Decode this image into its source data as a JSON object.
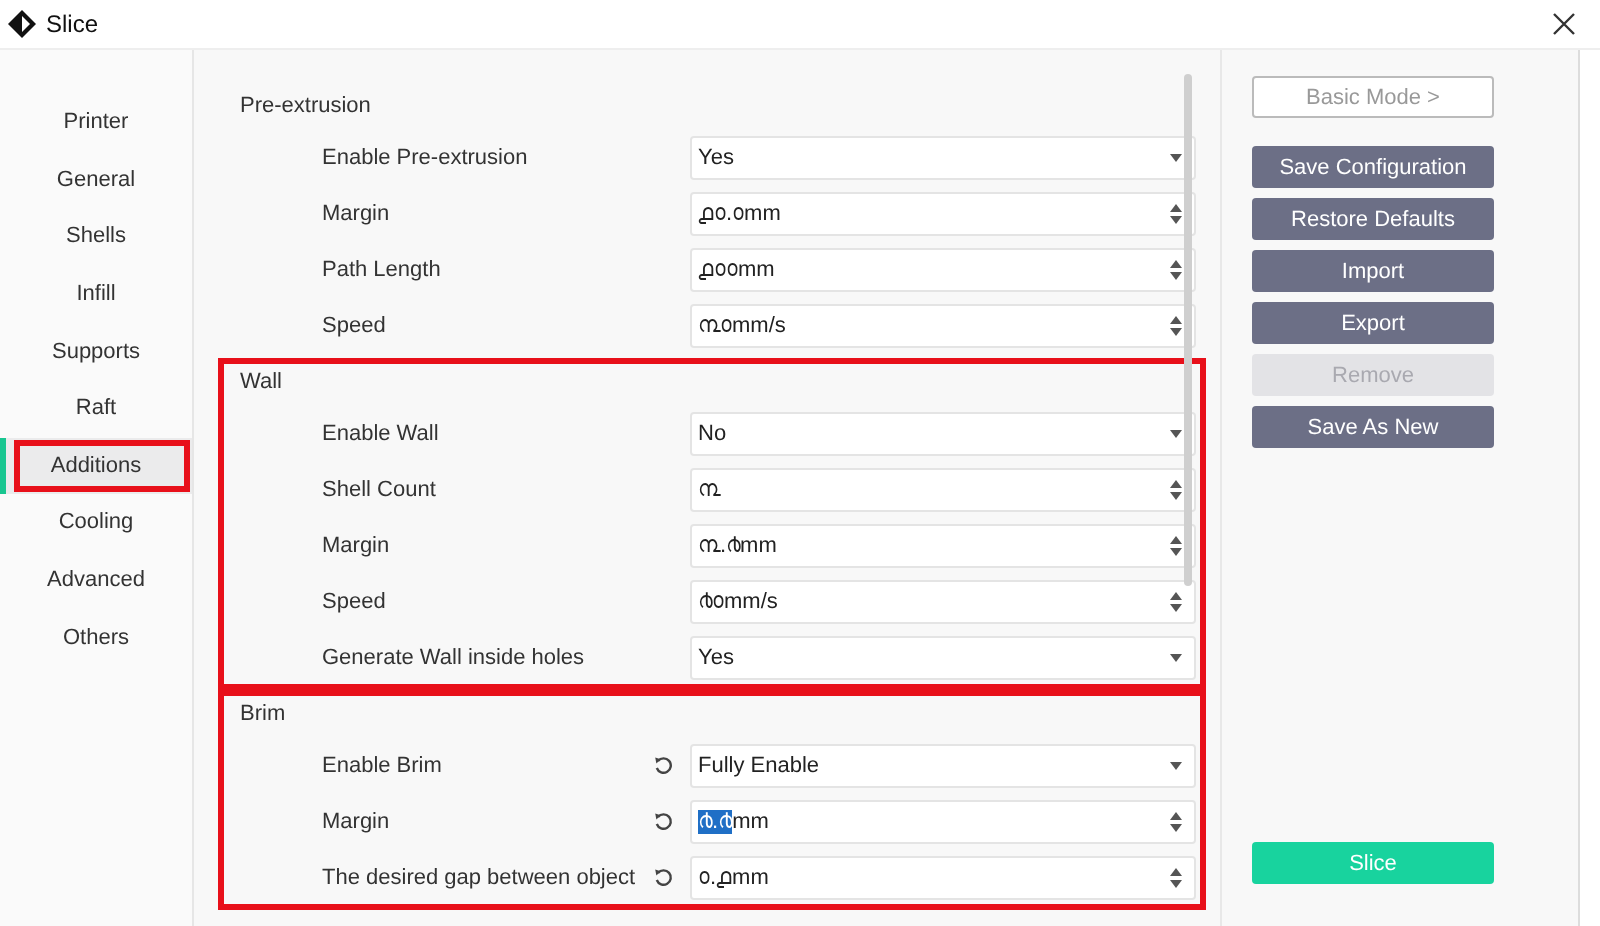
{
  "window": {
    "title": "Slice"
  },
  "sidebar": {
    "items": [
      {
        "label": "Printer",
        "selected": false,
        "highlighted": false
      },
      {
        "label": "General",
        "selected": false,
        "highlighted": false
      },
      {
        "label": "Shells",
        "selected": false,
        "highlighted": false
      },
      {
        "label": "Infill",
        "selected": false,
        "highlighted": false
      },
      {
        "label": "Supports",
        "selected": false,
        "highlighted": false
      },
      {
        "label": "Raft",
        "selected": false,
        "highlighted": false
      },
      {
        "label": "Additions",
        "selected": true,
        "highlighted": true
      },
      {
        "label": "Cooling",
        "selected": false,
        "highlighted": false
      },
      {
        "label": "Advanced",
        "selected": false,
        "highlighted": false
      },
      {
        "label": "Others",
        "selected": false,
        "highlighted": false
      }
    ]
  },
  "sections": [
    {
      "title": "Pre-extrusion",
      "highlighted": false,
      "rows": [
        {
          "label": "Enable Pre-extrusion",
          "kind": "select",
          "reset": false,
          "value": [
            {
              "text": "Yes",
              "selected": false
            }
          ]
        },
        {
          "label": "Margin",
          "kind": "spin",
          "reset": false,
          "value": [
            {
              "text": "൧൦.൦mm",
              "selected": false
            }
          ]
        },
        {
          "label": "Path Length",
          "kind": "spin",
          "reset": false,
          "value": [
            {
              "text": "൧൦൦mm",
              "selected": false
            }
          ]
        },
        {
          "label": "Speed",
          "kind": "spin",
          "reset": false,
          "value": [
            {
              "text": "൩൦mm/s",
              "selected": false
            }
          ]
        }
      ]
    },
    {
      "title": "Wall",
      "highlighted": true,
      "rows": [
        {
          "label": "Enable Wall",
          "kind": "select",
          "reset": false,
          "value": [
            {
              "text": "No",
              "selected": false
            }
          ]
        },
        {
          "label": "Shell Count",
          "kind": "spin",
          "reset": false,
          "value": [
            {
              "text": "൩",
              "selected": false
            }
          ]
        },
        {
          "label": "Margin",
          "kind": "spin",
          "reset": false,
          "value": [
            {
              "text": "൩.൪mm",
              "selected": false
            }
          ]
        },
        {
          "label": "Speed",
          "kind": "spin",
          "reset": false,
          "value": [
            {
              "text": "൪൦mm/s",
              "selected": false
            }
          ]
        },
        {
          "label": "Generate Wall inside holes",
          "kind": "select",
          "reset": false,
          "value": [
            {
              "text": "Yes",
              "selected": false
            }
          ]
        }
      ]
    },
    {
      "title": "Brim",
      "highlighted": true,
      "rows": [
        {
          "label": "Enable Brim",
          "kind": "select",
          "reset": true,
          "value": [
            {
              "text": "Fully Enable",
              "selected": false
            }
          ]
        },
        {
          "label": "Margin",
          "kind": "spin",
          "reset": true,
          "value": [
            {
              "text": "൪.൪",
              "selected": true
            },
            {
              "text": "mm",
              "selected": false
            }
          ]
        },
        {
          "label": "The desired gap between object",
          "kind": "spin",
          "reset": true,
          "value": [
            {
              "text": "൦.൧mm",
              "selected": false
            }
          ]
        }
      ]
    }
  ],
  "actions": [
    {
      "label": "Basic Mode >",
      "kind": "outline",
      "disabled": false
    },
    {
      "label": "Save Configuration",
      "kind": "solid",
      "disabled": false
    },
    {
      "label": "Restore Defaults",
      "kind": "solid",
      "disabled": false
    },
    {
      "label": "Import",
      "kind": "solid",
      "disabled": false
    },
    {
      "label": "Export",
      "kind": "solid",
      "disabled": false
    },
    {
      "label": "Remove",
      "kind": "solid",
      "disabled": true
    },
    {
      "label": "Save As New",
      "kind": "solid",
      "disabled": false
    }
  ],
  "slice_button": {
    "label": "Slice"
  }
}
